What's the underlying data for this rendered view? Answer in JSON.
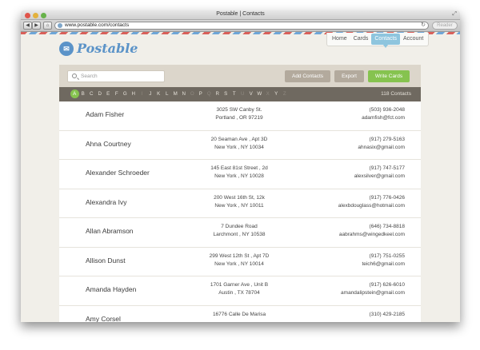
{
  "window": {
    "title": "Postable | Contacts"
  },
  "browser": {
    "url": "www.postable.com/contacts",
    "reader_label": "Reader"
  },
  "brand": {
    "name": "Postable"
  },
  "nav": {
    "items": [
      {
        "label": "Home"
      },
      {
        "label": "Cards"
      },
      {
        "label": "Contacts",
        "active": true
      },
      {
        "label": "Account"
      }
    ]
  },
  "toolbar": {
    "search_placeholder": "Search",
    "add_contacts_label": "Add Contacts",
    "export_label": "Export",
    "write_cards_label": "Write Cards"
  },
  "alphabet": {
    "letters": [
      "A",
      "B",
      "C",
      "D",
      "E",
      "F",
      "G",
      "H",
      "I",
      "J",
      "K",
      "L",
      "M",
      "N",
      "O",
      "P",
      "Q",
      "R",
      "S",
      "T",
      "U",
      "V",
      "W",
      "X",
      "Y",
      "Z"
    ],
    "active": "A",
    "dim": [
      "I",
      "O",
      "Q",
      "U",
      "X",
      "Z"
    ],
    "contact_count": "118 Contacts"
  },
  "contacts": [
    {
      "name": "Adam Fisher",
      "address_line1": "3025 SW Canby St.",
      "address_line2": "Portland , OR 97219",
      "phone": "(503) 936-2048",
      "email": "adamfish@fct.com"
    },
    {
      "name": "Ahna Courtney",
      "address_line1": "20 Seaman Ave , Apt 3D",
      "address_line2": "New York , NY 10034",
      "phone": "(917) 279-5163",
      "email": "ahnasix@gmail.com"
    },
    {
      "name": "Alexander Schroeder",
      "address_line1": "145 East 81st Street , 2d",
      "address_line2": "New York , NY 10028",
      "phone": "(917) 747-5177",
      "email": "alexsilver@gmail.com"
    },
    {
      "name": "Alexandra Ivy",
      "address_line1": "200 West 16th St, 12k",
      "address_line2": "New York , NY 10011",
      "phone": "(917) 776-0426",
      "email": "alexbdouglass@hotmail.com"
    },
    {
      "name": "Allan Abramson",
      "address_line1": "7 Dundee Road",
      "address_line2": "Larchmont , NY 10538",
      "phone": "(646) 734-8818",
      "email": "aabrahms@wingedkeel.com"
    },
    {
      "name": "Allison Dunst",
      "address_line1": "299 West 12th St , Apt 7D",
      "address_line2": "New York , NY 10014",
      "phone": "(917) 751-0255",
      "email": "teich6@gmail.com"
    },
    {
      "name": "Amanda Hayden",
      "address_line1": "1701 Garner Ave , Unit B",
      "address_line2": "Austin , TX 78704",
      "phone": "(917) 626-6010",
      "email": "amandalipstein@gmail.com"
    },
    {
      "name": "Amy Corsel",
      "address_line1": "16776 Calle De Marisa",
      "address_line2": "",
      "phone": "(310) 429-2185",
      "email": ""
    }
  ]
}
